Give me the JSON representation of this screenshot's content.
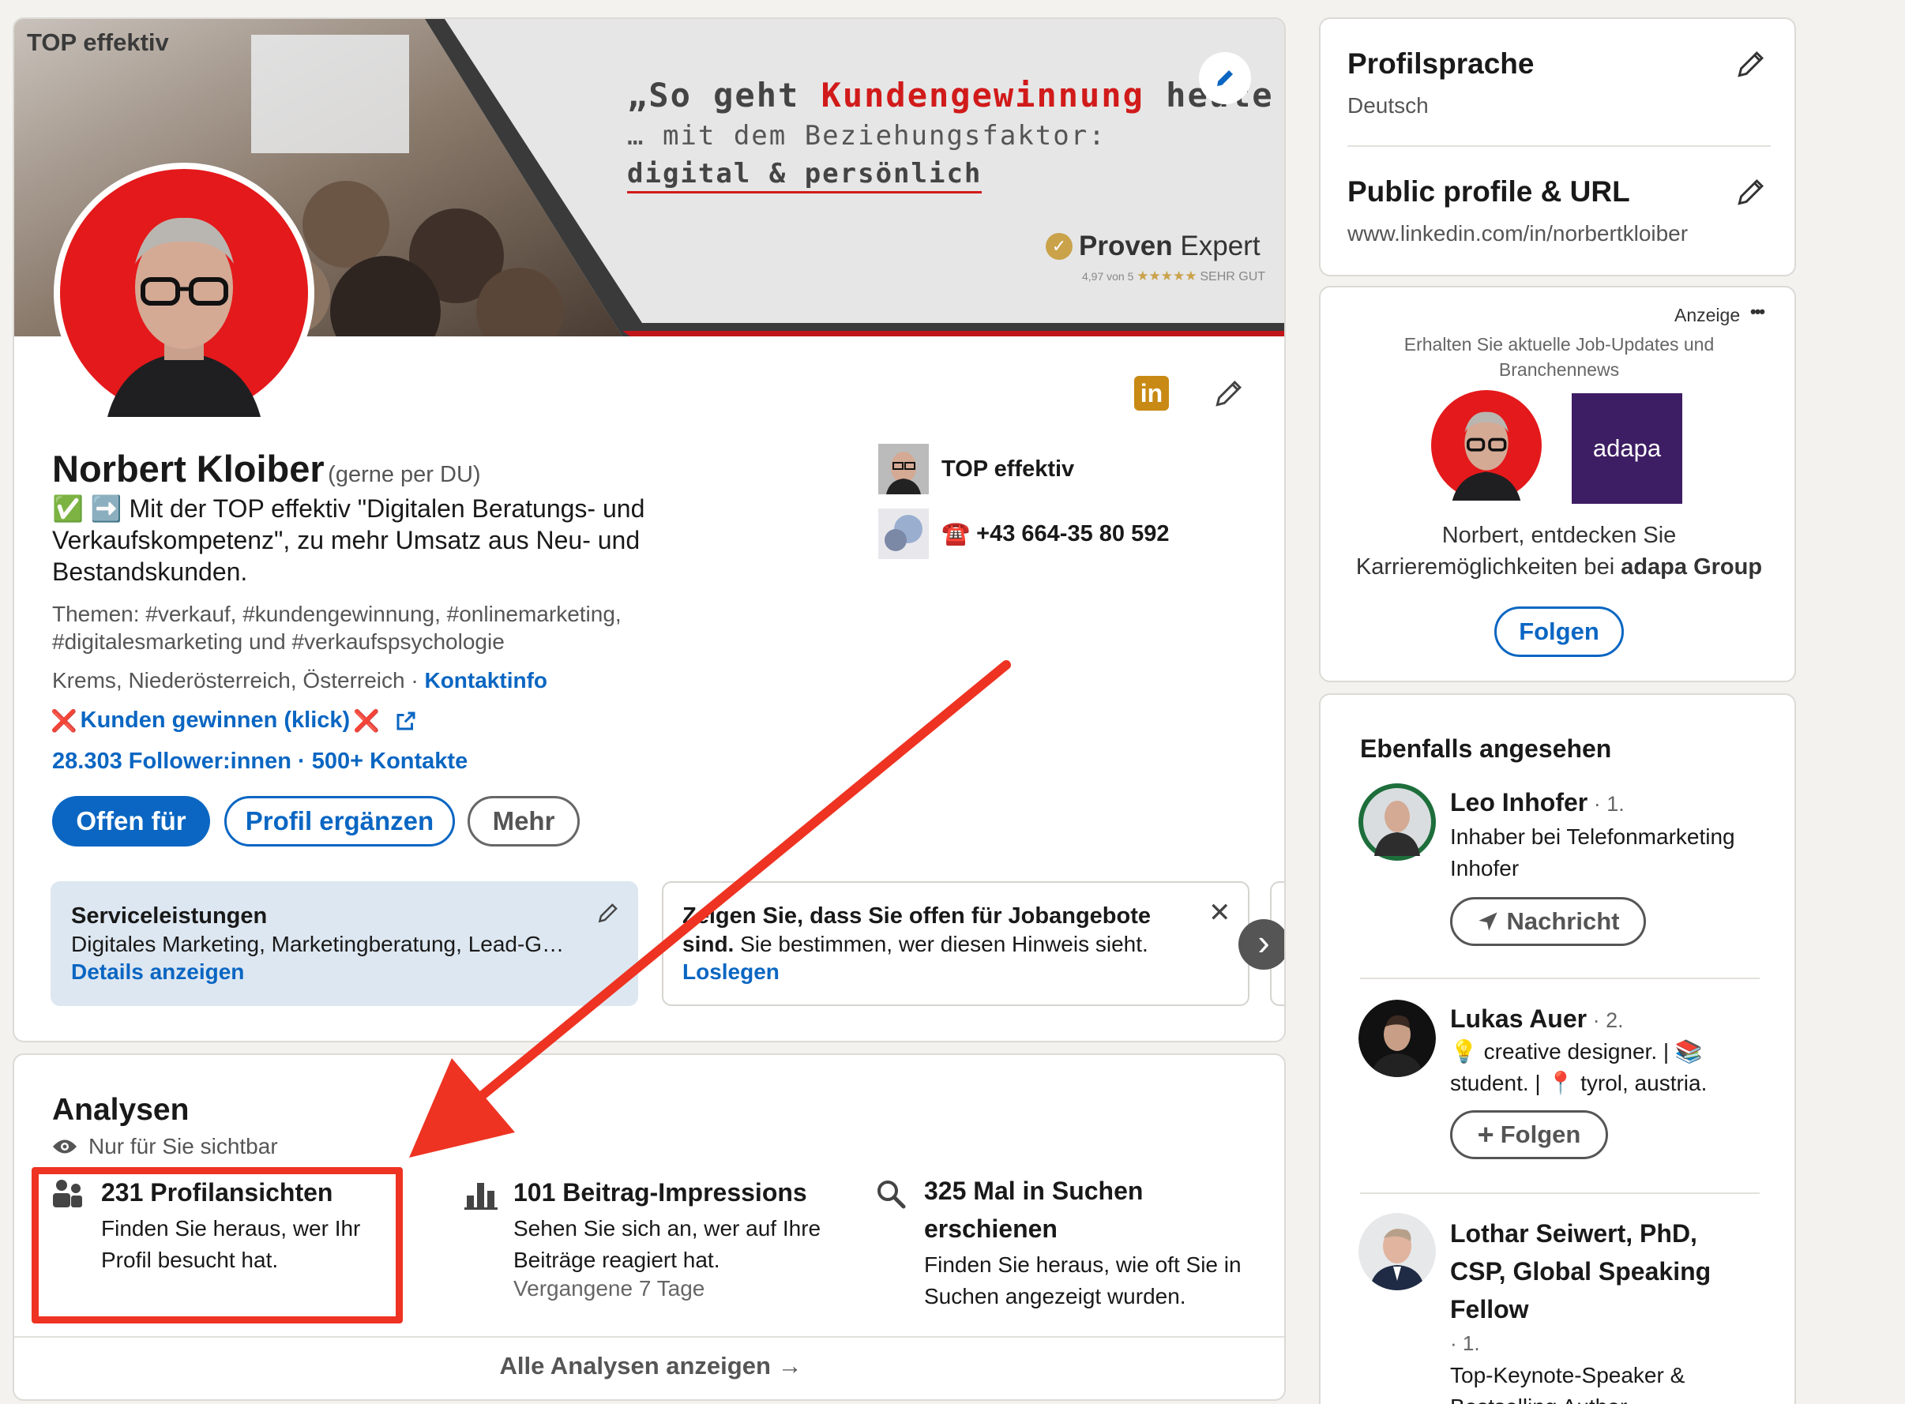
{
  "banner": {
    "company_tag": "TOP effektiv",
    "quote_open": "„So geht ",
    "quote_highlight": "Kundengewinnung",
    "quote_close": " heute",
    "line2": "… mit dem Beziehungsfaktor:",
    "line3": "digital & persönlich",
    "proven_bold": "Proven",
    "proven_light": "Expert",
    "rating_small": "4,97 von 5",
    "rating_stars": "★★★★★",
    "rating_label": "SEHR GUT"
  },
  "profile": {
    "name": "Norbert Kloiber",
    "name_note": "(gerne per DU)",
    "headline_icons": "✅ ➡️",
    "headline": "Mit der TOP effektiv \"Digitalen Beratungs- und Verkaufskompetenz\", zu mehr Umsatz aus Neu- und Bestandskunden.",
    "topics": "Themen: #verkauf, #kundengewinnung, #onlinemarketing, #digitalesmarketing und #verkaufspsychologie",
    "location": "Krems, Niederösterreich, Österreich · ",
    "contact_link": "Kontaktinfo",
    "website_mark": "❌",
    "website_label": "Kunden gewinnen (klick)",
    "followers": "28.303 Follower:innen",
    "connections": " · 500+ Kontakte",
    "btn_open": "Offen für",
    "btn_complete": "Profil ergänzen",
    "btn_more": "Mehr",
    "company": "TOP effektiv",
    "phone_icon": "☎️",
    "phone": "+43 664-35 80 592",
    "in_badge": "in"
  },
  "services": {
    "title": "Serviceleistungen",
    "desc": "Digitales Marketing, Marketingberatung, Lead-G…",
    "link": "Details anzeigen"
  },
  "jobs": {
    "title": "Zeigen Sie, dass Sie offen für Jobangebote",
    "bold2": "sind.",
    "text2": " Sie bestimmen, wer diesen Hinweis sieht.",
    "link": "Loslegen",
    "close": "✕",
    "next": "›"
  },
  "analytics": {
    "title": "Analysen",
    "visibility": "Nur für Sie sichtbar",
    "items": [
      {
        "title": "231 Profilansichten",
        "desc": "Finden Sie heraus, wer Ihr Profil besucht hat.",
        "sub": ""
      },
      {
        "title": "101 Beitrag-Impressions",
        "desc": "Sehen Sie sich an, wer auf Ihre Beiträge reagiert hat.",
        "sub": "Vergangene 7 Tage"
      },
      {
        "title": "325 Mal in Suchen erschienen",
        "desc": "Finden Sie heraus, wie oft Sie in Suchen angezeigt wurden.",
        "sub": ""
      }
    ],
    "show_all": "Alle Analysen anzeigen →"
  },
  "sidebar": {
    "lang_title": "Profilsprache",
    "lang_value": "Deutsch",
    "url_title": "Public profile & URL",
    "url_value": "www.linkedin.com/in/norbertkloiber",
    "ad": {
      "label": "Anzeige",
      "dots": "•••",
      "subtitle": "Erhalten Sie aktuelle Job-Updates und Branchennews",
      "logo_text": "adapa",
      "text": "Norbert, entdecken Sie Karrieremöglichkeiten bei ",
      "company": "adapa Group",
      "button": "Folgen",
      "logo_color": "#3d1d63"
    },
    "also": {
      "title": "Ebenfalls angesehen",
      "people": [
        {
          "name": "Leo Inhofer",
          "degree": " · 1.",
          "desc": "Inhaber bei Telefonmarketing Inhofer",
          "button": "Nachricht",
          "button_icon": "send-icon",
          "badge": "OPENTOWORK"
        },
        {
          "name": "Lukas Auer",
          "degree": " · 2.",
          "desc": "💡 creative designer. | 📚 student. | 📍 tyrol, austria.",
          "button": "Folgen",
          "button_icon": "plus-icon"
        },
        {
          "name": "Lothar Seiwert, PhD, CSP, Global Speaking Fellow",
          "degree": "· 1.",
          "desc": "Top-Keynote-Speaker & Bestselling Author"
        }
      ]
    }
  },
  "annotation": {
    "color": "#ee3322"
  },
  "colors": {
    "brand_red": "#e01e1e",
    "link_blue": "#0a66c2",
    "green": "#057642"
  }
}
